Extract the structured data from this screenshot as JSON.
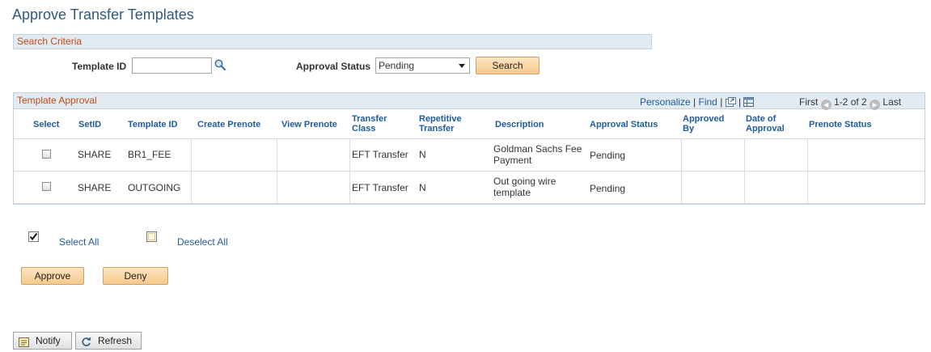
{
  "page": {
    "title": "Approve Transfer Templates"
  },
  "search_criteria": {
    "section_label": "Search Criteria",
    "template_id_label": "Template ID",
    "template_id_value": "",
    "approval_status_label": "Approval Status",
    "approval_status_value": "Pending",
    "search_button": "Search"
  },
  "grid": {
    "title": "Template Approval",
    "personalize": "Personalize",
    "find": "Find",
    "separator": "|",
    "first": "First",
    "range": "1-2 of 2",
    "last": "Last",
    "columns": [
      "Select",
      "SetID",
      "Template ID",
      "Create Prenote",
      "View Prenote",
      "Transfer Class",
      "Repetitive Transfer",
      "Description",
      "Approval Status",
      "Approved By",
      "Date of Approval",
      "Prenote Status"
    ],
    "rows": [
      {
        "selected": false,
        "setid": "SHARE",
        "template_id": "BR1_FEE",
        "create_prenote": "",
        "view_prenote": "",
        "transfer_class": "EFT Transfer",
        "repetitive": "N",
        "description": "Goldman Sachs Fee Payment",
        "approval_status": "Pending",
        "approved_by": "",
        "date_of_approval": "",
        "prenote_status": ""
      },
      {
        "selected": false,
        "setid": "SHARE",
        "template_id": "OUTGOING",
        "create_prenote": "",
        "view_prenote": "",
        "transfer_class": "EFT Transfer",
        "repetitive": "N",
        "description": "Out going wire template",
        "approval_status": "Pending",
        "approved_by": "",
        "date_of_approval": "",
        "prenote_status": ""
      }
    ]
  },
  "actions": {
    "select_all": "Select All",
    "deselect_all": "Deselect All",
    "approve": "Approve",
    "deny": "Deny"
  },
  "toolbar": {
    "notify": "Notify",
    "refresh": "Refresh"
  },
  "colors": {
    "title_blue": "#2f5a82",
    "section_orange": "#c44a16",
    "link_blue": "#1f5b9a",
    "header_bg": "#e2ebf2"
  }
}
